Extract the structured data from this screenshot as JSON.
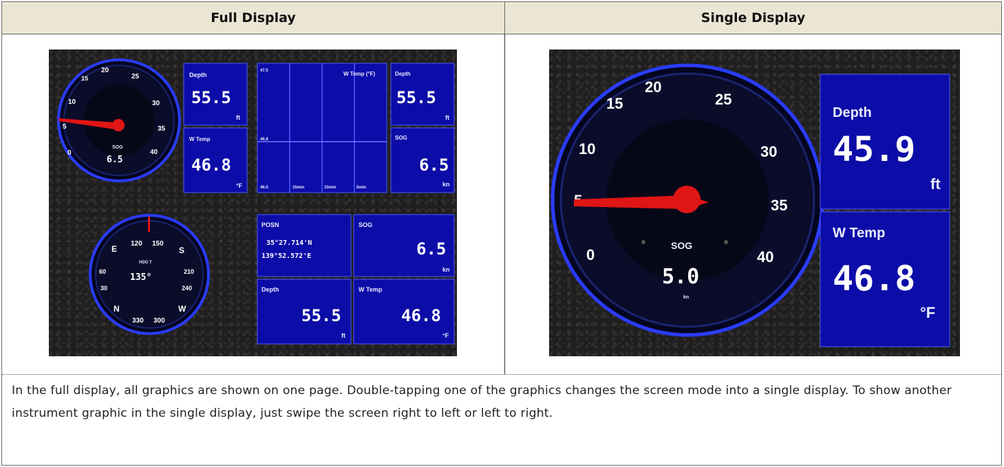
{
  "table": {
    "header_left": "Full Display",
    "header_right": "Single Display",
    "caption": "In the full display, all graphics are shown on one page. Double-tapping one of the graphics changes the screen mode into a single display. To show another instrument graphic in the single display, just swipe the screen right to left or left to right."
  },
  "colors": {
    "panel": "#0c0ca8",
    "panel_border": "#4d5cff",
    "needle": "#e01515",
    "dial_ring": "#2a3cff"
  },
  "full": {
    "sog_dial": {
      "ticks": [
        "15",
        "20",
        "25",
        "10",
        "30",
        "5",
        "35",
        "0",
        "40"
      ],
      "label": "SOG",
      "value": "6.5",
      "needle_value": 5
    },
    "depth1": {
      "label": "Depth",
      "value": "55.5",
      "unit": "ft"
    },
    "wtemp1": {
      "label": "W Temp",
      "value": "46.8",
      "unit": "°F"
    },
    "graph": {
      "title": "W Temp (°F)",
      "top_val": "47.5",
      "mid_val": "46.8",
      "bottom_val": "46.0",
      "x_labels": [
        "15min",
        "10min",
        "5min"
      ]
    },
    "depth2": {
      "label": "Depth",
      "value": "55.5",
      "unit": "ft"
    },
    "sog2": {
      "label": "SOG",
      "value": "6.5",
      "unit": "kn"
    },
    "compass": {
      "labels": [
        "120",
        "150",
        "E",
        "S",
        "60",
        "210",
        "30",
        "240",
        "N",
        "W",
        "330",
        "300"
      ],
      "hdg_label": "HDG T",
      "value": "135°"
    },
    "posn": {
      "label": "POSN",
      "lat": "35°27.714'N",
      "lon": "139°52.572'E"
    },
    "sog3": {
      "label": "SOG",
      "value": "6.5",
      "unit": "kn"
    },
    "depth3": {
      "label": "Depth",
      "value": "55.5",
      "unit": "ft"
    },
    "wtemp3": {
      "label": "W Temp",
      "value": "46.8",
      "unit": "°F"
    }
  },
  "single": {
    "sog_dial": {
      "ticks": [
        "15",
        "20",
        "25",
        "10",
        "30",
        "5",
        "35",
        "0",
        "40"
      ],
      "label": "SOG",
      "value": "5.0",
      "unit": "kn",
      "needle_value": 5
    },
    "depth": {
      "label": "Depth",
      "value": "45.9",
      "unit": "ft"
    },
    "wtemp": {
      "label": "W Temp",
      "value": "46.8",
      "unit": "°F"
    }
  }
}
